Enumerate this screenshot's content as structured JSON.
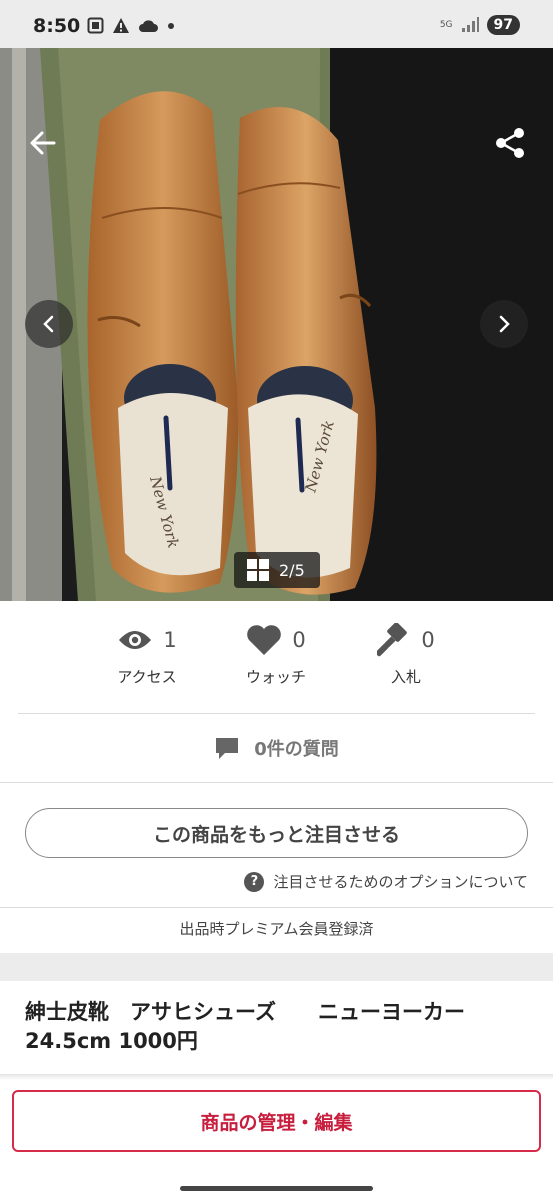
{
  "status_bar": {
    "time": "8:50",
    "network": "5G",
    "battery": "97"
  },
  "photo": {
    "page_indicator": "2/5",
    "insole_brand": "New York"
  },
  "stats": {
    "access": {
      "count": "1",
      "label": "アクセス"
    },
    "watch": {
      "count": "0",
      "label": "ウォッチ"
    },
    "bids": {
      "count": "0",
      "label": "入札"
    }
  },
  "questions": {
    "label": "0件の質問"
  },
  "promote": {
    "button_label": "この商品をもっと注目させる",
    "help_label": "注目させるためのオプションについて",
    "help_icon": "?"
  },
  "premium_note": "出品時プレミアム会員登録済",
  "item": {
    "title": "紳士皮靴　アサヒシューズ　　ニューヨーカー\n24.5cm 1000円"
  },
  "actions": {
    "manage_label": "商品の管理・編集"
  },
  "colors": {
    "accent": "#c81e3e",
    "leather": "#c8874a"
  }
}
